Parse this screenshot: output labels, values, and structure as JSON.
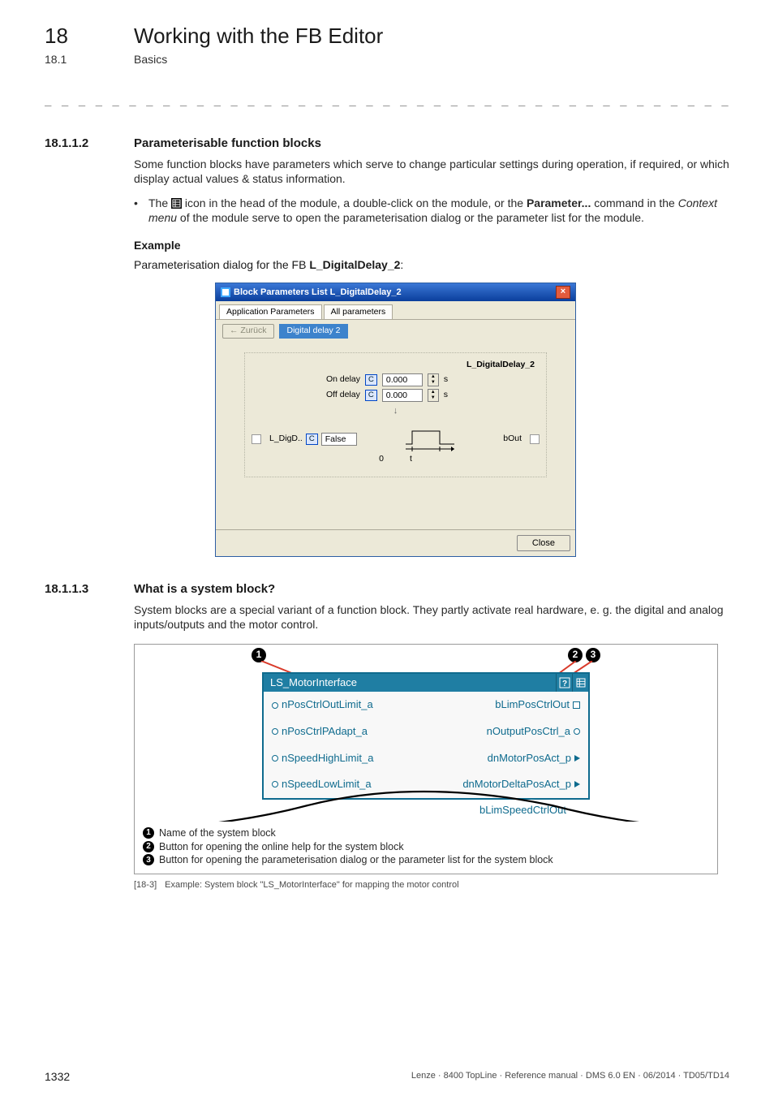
{
  "header": {
    "chapter_number": "18",
    "chapter_title": "Working with the FB Editor",
    "section_number": "18.1",
    "section_title": "Basics",
    "dashes": "_ _ _ _ _ _ _ _ _ _ _ _ _ _ _ _ _ _ _ _ _ _ _ _ _ _ _ _ _ _ _ _ _ _ _ _ _ _ _ _ _ _ _ _ _ _ _ _ _ _ _ _ _ _ _ _ _ _ _ _ _ _ _"
  },
  "sec_a": {
    "num": "18.1.1.2",
    "title": "Parameterisable function blocks",
    "para": "Some function blocks have parameters which serve to change particular settings during operation, if required, or which display actual values & status information.",
    "bullet_pre": "The ",
    "bullet_mid1": " icon in the head of the module, a double-click on the module, or the ",
    "bullet_bold": "Parameter...",
    "bullet_mid2": " command in the ",
    "bullet_em": "Context menu",
    "bullet_post": " of the module serve to open the parameterisation dialog or the parameter list for the module.",
    "example_head": "Example",
    "example_text_pre": "Parameterisation dialog for the FB ",
    "example_text_bold": "L_DigitalDelay_2",
    "example_text_post": ":"
  },
  "dlg": {
    "title": "Block Parameters List L_DigitalDelay_2",
    "tab1": "Application Parameters",
    "tab2": "All parameters",
    "back": "← Zurück",
    "crumb": "Digital delay 2",
    "fb_label": "L_DigitalDelay_2",
    "on_delay_label": "On delay",
    "off_delay_label": "Off delay",
    "c_label": "C",
    "on_val": "0.000",
    "off_val": "0.000",
    "unit": "s",
    "in_port": "L_DigD..",
    "in_val": "False",
    "out_port": "bOut",
    "axis0": "0",
    "axist": "t",
    "close": "Close"
  },
  "sec_b": {
    "num": "18.1.1.3",
    "title": "What is a system block?",
    "para": "System blocks are a special variant of a function block. They partly activate real hardware, e. g. the digital and analog inputs/outputs and the motor control."
  },
  "sysblock": {
    "name": "LS_MotorInterface",
    "inputs": [
      "nPosCtrlOutLimit_a",
      "nPosCtrlPAdapt_a",
      "nSpeedHighLimit_a",
      "nSpeedLowLimit_a"
    ],
    "outputs": [
      "bLimPosCtrlOut",
      "nOutputPosCtrl_a",
      "dnMotorPosAct_p",
      "dnMotorDeltaPosAct_p"
    ],
    "cutoff": "bLimSpeedCtrlOut"
  },
  "legend": {
    "l1": "Name of the system block",
    "l2": "Button for opening the online help for the system block",
    "l3": "Button for opening the parameterisation dialog or the parameter list for the system block"
  },
  "fig_caption": {
    "tag": "[18-3]",
    "text": "Example: System block \"LS_MotorInterface\" for mapping the motor control"
  },
  "footer": {
    "page": "1332",
    "right": "Lenze · 8400 TopLine · Reference manual · DMS 6.0 EN · 06/2014 · TD05/TD14"
  }
}
